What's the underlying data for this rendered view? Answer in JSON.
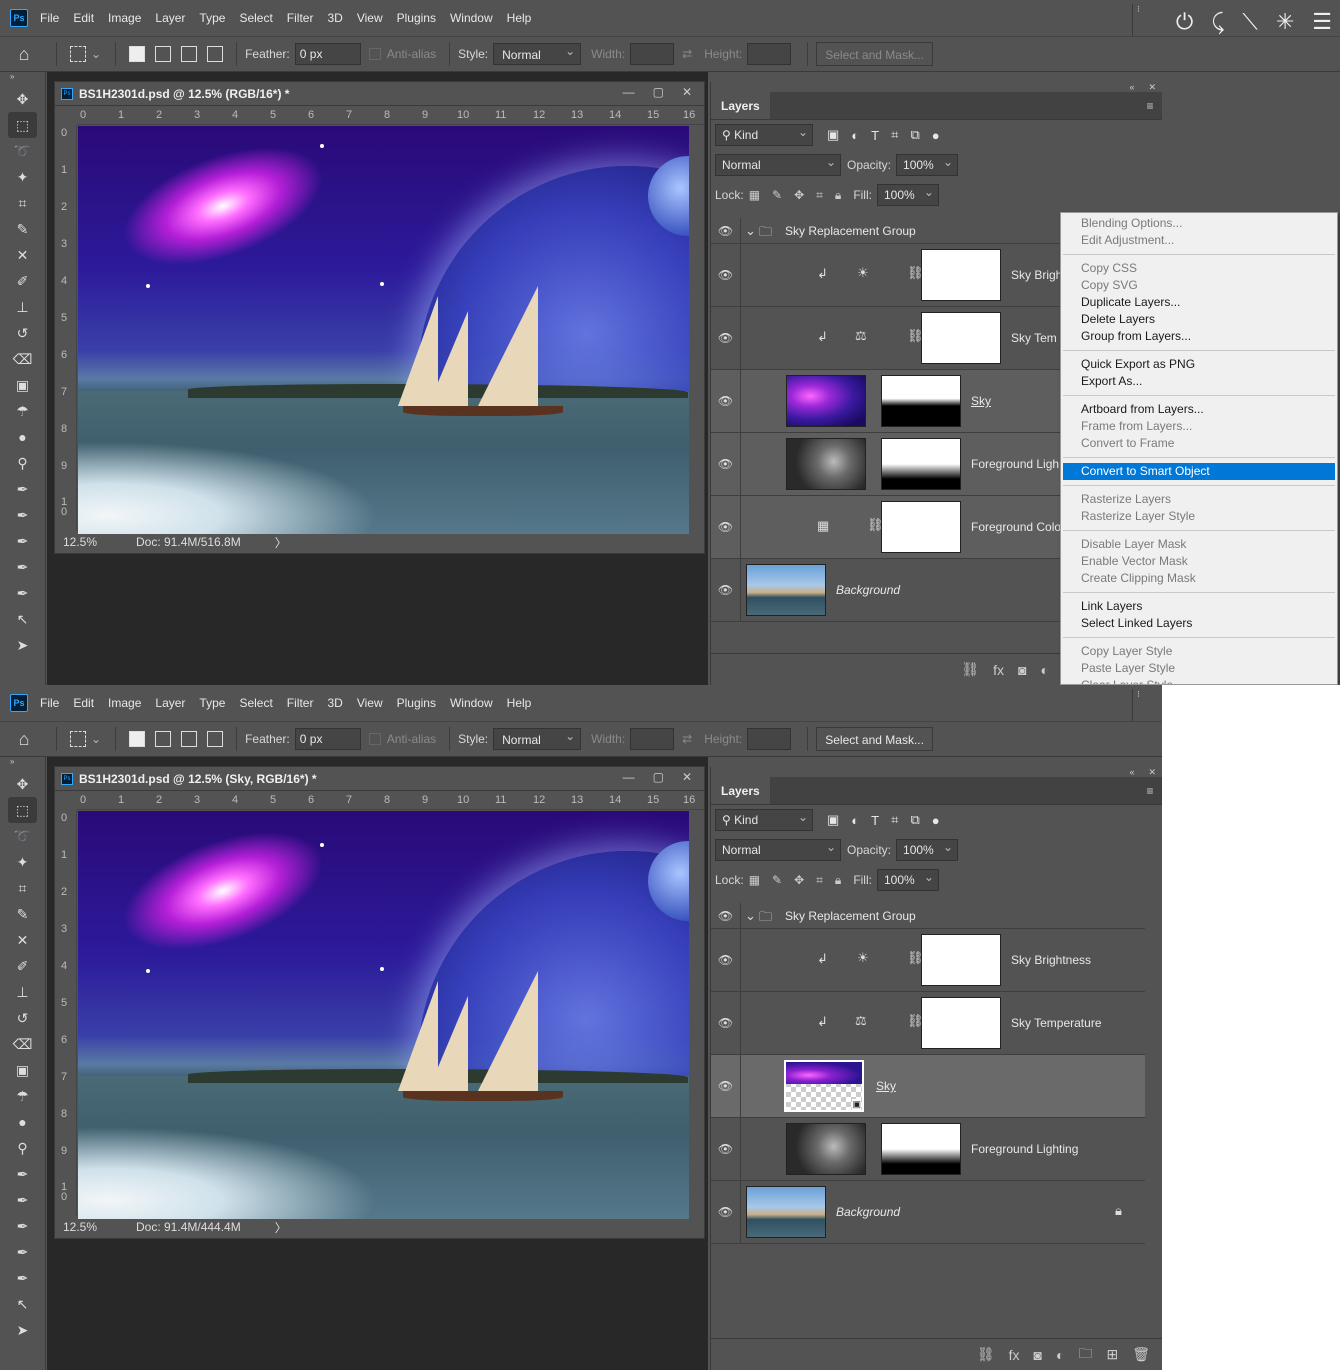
{
  "menu": [
    "File",
    "Edit",
    "Image",
    "Layer",
    "Type",
    "Select",
    "Filter",
    "3D",
    "View",
    "Plugins",
    "Window",
    "Help"
  ],
  "options": {
    "feather_label": "Feather:",
    "feather_value": "0 px",
    "antialias_label": "Anti-alias",
    "style_label": "Style:",
    "style_value": "Normal",
    "width_label": "Width:",
    "height_label": "Height:",
    "select_mask_label": "Select and Mask..."
  },
  "top": {
    "doc_title": "BS1H2301d.psd @ 12.5% (RGB/16*) *",
    "zoom": "12.5%",
    "doc_info": "Doc: 91.4M/516.8M",
    "layers": {
      "group": "Sky Replacement Group",
      "l1": "Sky Brigh",
      "l2": "Sky Tem",
      "l3": "Sky",
      "l4": "Foreground Ligh",
      "l5": "Foreground Colo",
      "l6": "Background"
    },
    "context_menu": {
      "g1": [
        "Blending Options...",
        "Edit Adjustment..."
      ],
      "g2": [
        "Copy CSS",
        "Copy SVG",
        "Duplicate Layers...",
        "Delete Layers",
        "Group from Layers..."
      ],
      "g3": [
        "Quick Export as PNG",
        "Export As..."
      ],
      "g4": [
        "Artboard from Layers...",
        "Frame from Layers...",
        "Convert to Frame"
      ],
      "g5": [
        "Convert to Smart Object"
      ],
      "g6": [
        "Rasterize Layers",
        "Rasterize Layer Style"
      ],
      "g7": [
        "Disable Layer Mask",
        "Enable Vector Mask",
        "Create Clipping Mask"
      ],
      "g8": [
        "Link Layers",
        "Select Linked Layers"
      ],
      "g9": [
        "Copy Layer Style",
        "Paste Layer Style",
        "Clear Layer Style"
      ]
    }
  },
  "bottom": {
    "doc_title": "BS1H2301d.psd @ 12.5% (Sky, RGB/16*) *",
    "zoom": "12.5%",
    "doc_info": "Doc: 91.4M/444.4M",
    "layers": {
      "group": "Sky Replacement Group",
      "l1": "Sky Brightness",
      "l2": "Sky Temperature",
      "l3": "Sky",
      "l4": "Foreground Lighting",
      "l5": "Background"
    }
  },
  "panel": {
    "tab": "Layers",
    "filter_kind": "Kind",
    "blend_mode": "Normal",
    "opacity_label": "Opacity:",
    "opacity_value": "100%",
    "lock_label": "Lock:",
    "fill_label": "Fill:",
    "fill_value": "100%"
  },
  "ruler_h": [
    "0",
    "1",
    "2",
    "3",
    "4",
    "5",
    "6",
    "7",
    "8",
    "9",
    "10",
    "11",
    "12",
    "13",
    "14",
    "15",
    "16"
  ],
  "ruler_v": [
    "0",
    "1",
    "2",
    "3",
    "4",
    "5",
    "6",
    "7",
    "8",
    "9",
    "1 0"
  ],
  "colors": {
    "highlight": "#0078d7",
    "ui_bg": "#535353",
    "workspace": "#282828"
  }
}
